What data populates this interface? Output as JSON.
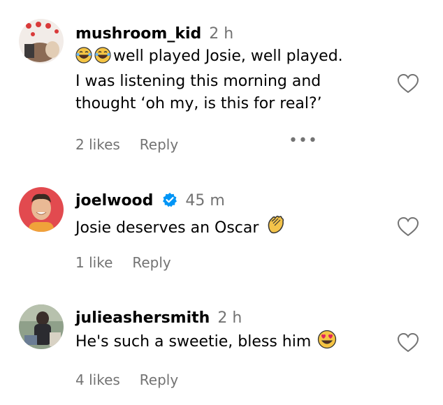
{
  "comments": [
    {
      "username": "mushroom_kid",
      "time": "2 h",
      "emoji_icons": [
        "laughing-tears-icon",
        "laughing-tears-icon"
      ],
      "text_line1": "well played Josie, well played.",
      "text_line2": "I was listening this morning and",
      "text_line3": "thought ‘oh my, is this for real?’",
      "likes": "2 likes",
      "reply": "Reply",
      "more": "•••"
    },
    {
      "username": "joelwood",
      "verified": true,
      "time": "45 m",
      "text": "Josie deserves an Oscar",
      "emoji_icon": "clapping-hands-icon",
      "likes": "1 like",
      "reply": "Reply"
    },
    {
      "username": "julieashersmith",
      "time": "2 h",
      "text": "He's such a sweetie, bless him",
      "emoji_icon": "heart-eyes-icon",
      "likes": "4 likes",
      "reply": "Reply"
    }
  ],
  "colors": {
    "text": "#000000",
    "secondary": "#737373",
    "verified": "#0095f6"
  }
}
